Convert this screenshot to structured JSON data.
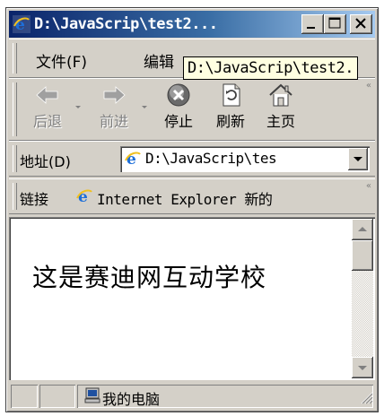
{
  "window": {
    "title": "D:\\JavaScrip\\test2..."
  },
  "menubar": {
    "items": [
      {
        "label": "文件(F)"
      },
      {
        "label": "编辑"
      }
    ],
    "tooltip": "D:\\JavaScrip\\test2."
  },
  "toolbar": {
    "back_label": "后退",
    "forward_label": "前进",
    "stop_label": "停止",
    "refresh_label": "刷新",
    "home_label": "主页"
  },
  "address": {
    "label": "地址(D)",
    "value": "D:\\JavaScrip\\tes"
  },
  "links": {
    "label": "链接",
    "item": "Internet Explorer 新的"
  },
  "content": {
    "text": "这是赛迪网互动学校"
  },
  "status": {
    "zone": "我的电脑"
  },
  "colors": {
    "title_start": "#0a246a",
    "title_end": "#a6caf0",
    "chrome": "#d4d0c8",
    "tooltip_bg": "#ffffe1"
  }
}
